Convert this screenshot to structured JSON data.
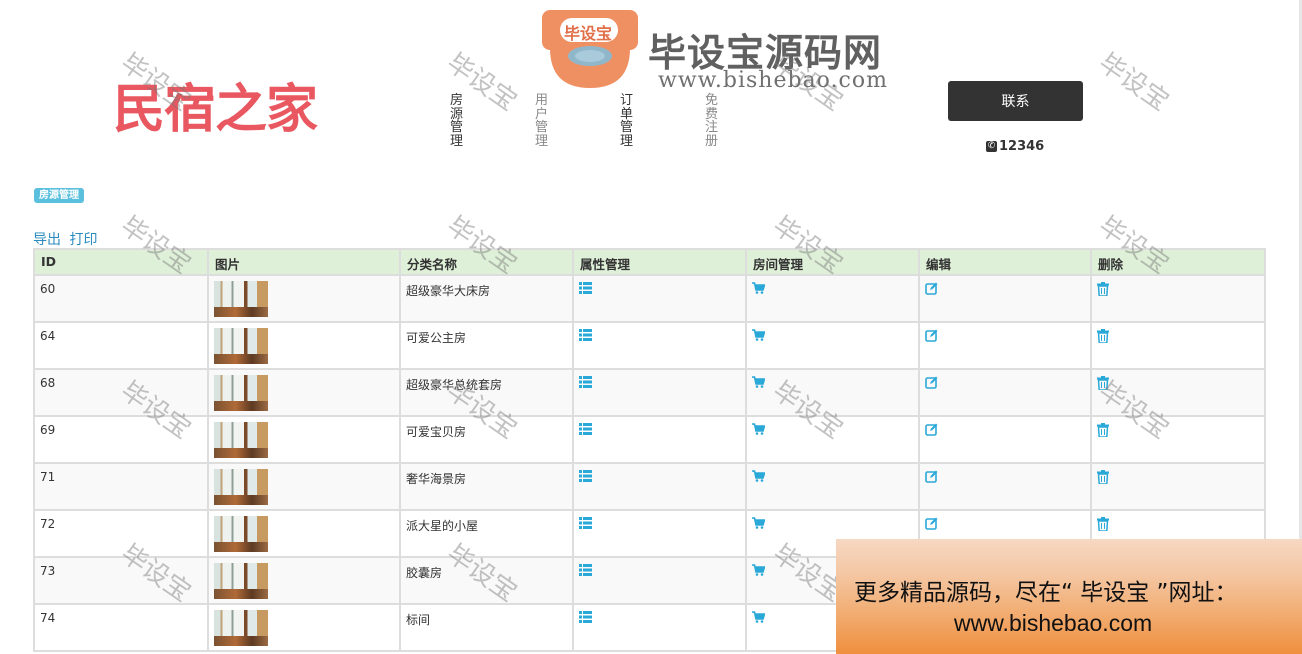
{
  "header": {
    "logo": "民宿之家",
    "nav": [
      {
        "label": "房源管理",
        "muted": false
      },
      {
        "label": "用户管理",
        "muted": true
      },
      {
        "label": "订单管理",
        "muted": false
      },
      {
        "label": "免费注册",
        "muted": true
      }
    ],
    "contact_button": "联系",
    "phone": "12346"
  },
  "watermark": {
    "badge_text": "毕设宝",
    "title": "毕设宝源码网",
    "url": "www.bishebao.com",
    "stamp": "毕设宝"
  },
  "page": {
    "badge": "房源管理",
    "export": "导出",
    "print": "打印"
  },
  "table": {
    "headers": [
      "ID",
      "图片",
      "分类名称",
      "属性管理",
      "房间管理",
      "编辑",
      "删除"
    ],
    "rows": [
      {
        "id": "60",
        "name": "超级豪华大床房"
      },
      {
        "id": "64",
        "name": "可爱公主房"
      },
      {
        "id": "68",
        "name": "超级豪华总统套房"
      },
      {
        "id": "69",
        "name": "可爱宝贝房"
      },
      {
        "id": "71",
        "name": "奢华海景房"
      },
      {
        "id": "72",
        "name": "派大星的小屋"
      },
      {
        "id": "73",
        "name": "胶囊房"
      },
      {
        "id": "74",
        "name": "标间"
      }
    ]
  },
  "ad": {
    "line1": "更多精品源码，尽在“ 毕设宝 ”网址：",
    "line2": "www.bishebao.com"
  },
  "colors": {
    "accent": "#2aa8d8",
    "header_row": "#dff0d8",
    "logo": "#e95860",
    "badge": "#5bc0de"
  }
}
